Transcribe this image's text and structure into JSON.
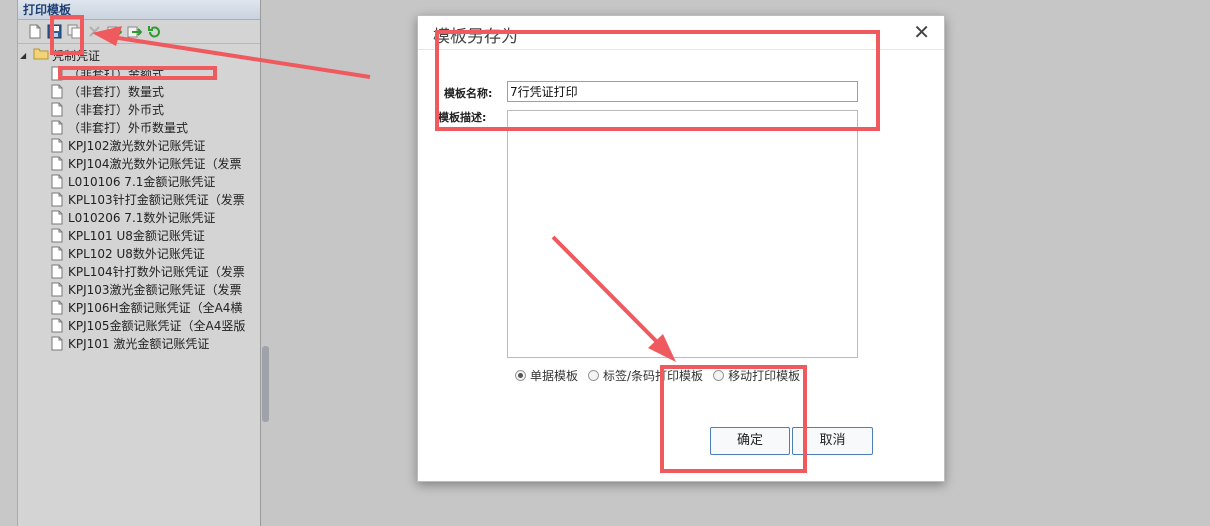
{
  "panel": {
    "title": "打印模板",
    "toolbar": [
      "new-doc-icon",
      "save-as-icon",
      "copy-icon",
      "delete-icon",
      "import-icon",
      "export-icon",
      "refresh-icon"
    ]
  },
  "tree": {
    "root": "凭制凭证",
    "items": [
      "（非套打）金额式",
      "（非套打）数量式",
      "（非套打）外币式",
      "（非套打）外币数量式",
      "KPJ102激光数外记账凭证",
      "KPJ104激光数外记账凭证（发票",
      "L010106 7.1金额记账凭证",
      "KPL103针打金额记账凭证（发票",
      "L010206 7.1数外记账凭证",
      "KPL101 U8金额记账凭证",
      "KPL102 U8数外记账凭证",
      "KPL104针打数外记账凭证（发票",
      "KPJ103激光金额记账凭证（发票",
      "KPJ106H金额记账凭证（全A4横",
      "KPJ105金额记账凭证（全A4竖版",
      "KPJ101 激光金额记账凭证"
    ]
  },
  "dialog": {
    "title": "模板另存为",
    "close": "✕",
    "name_label": "模板名称:",
    "name_value": "7行凭证打印",
    "desc_label": "模板描述:",
    "radios": [
      {
        "label": "单据模板",
        "checked": true
      },
      {
        "label": "标签/条码打印模板",
        "checked": false
      },
      {
        "label": "移动打印模板",
        "checked": false
      }
    ],
    "ok": "确定",
    "cancel": "取消"
  },
  "annotation_color": "#ef5a5f"
}
